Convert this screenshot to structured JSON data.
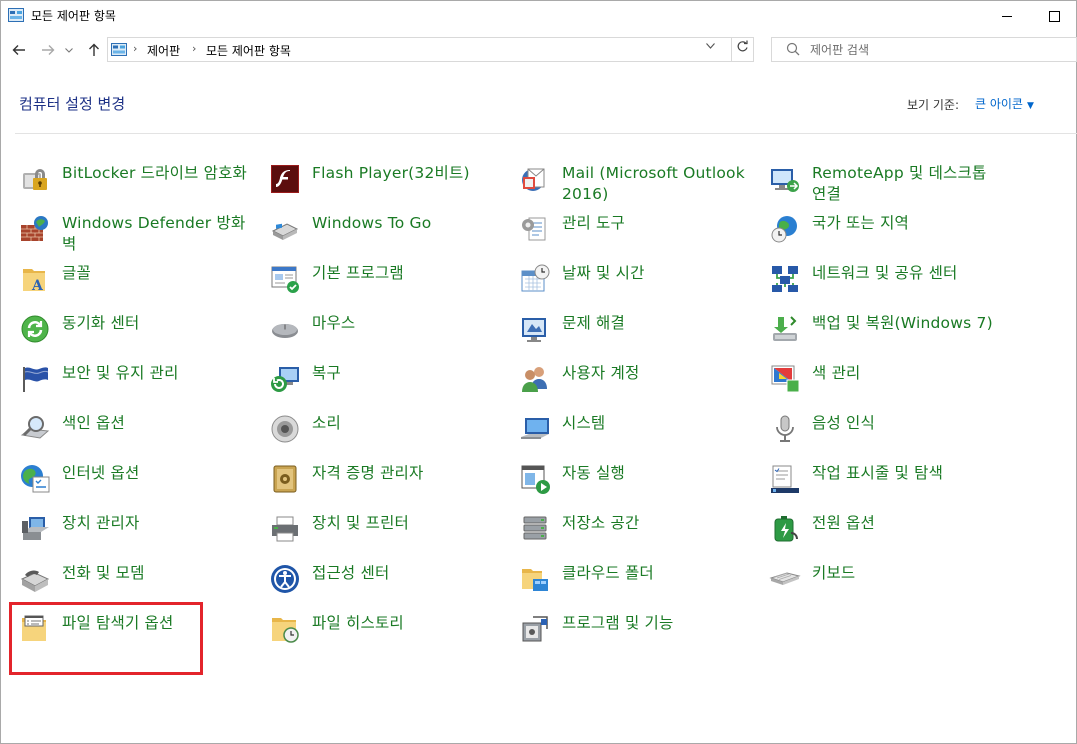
{
  "window": {
    "title": "모든 제어판 항목"
  },
  "nav": {
    "back_icon": "arrow-left-icon",
    "forward_icon": "arrow-right-icon",
    "recent_icon": "chevron-down-icon",
    "up_icon": "arrow-up-icon"
  },
  "address": {
    "crumbs": [
      "제어판",
      "모든 제어판 항목"
    ],
    "refresh_icon": "refresh-icon"
  },
  "search": {
    "placeholder": "제어판 검색"
  },
  "header": {
    "title": "컴퓨터 설정 변경",
    "view_label": "보기 기준:",
    "view_value": "큰 아이콘"
  },
  "items": [
    {
      "label": "BitLocker 드라이브 암호화",
      "icon": "bitlocker-icon"
    },
    {
      "label": "Flash Player(32비트)",
      "icon": "flash-icon"
    },
    {
      "label": "Mail (Microsoft Outlook 2016)",
      "icon": "mail-icon"
    },
    {
      "label": "RemoteApp 및 데스크톱 연결",
      "icon": "remoteapp-icon"
    },
    {
      "label": "Windows Defender 방화벽",
      "icon": "firewall-icon"
    },
    {
      "label": "Windows To Go",
      "icon": "usb-drive-icon"
    },
    {
      "label": "관리 도구",
      "icon": "admin-tools-icon"
    },
    {
      "label": "국가 또는 지역",
      "icon": "globe-clock-icon"
    },
    {
      "label": "글꼴",
      "icon": "fonts-folder-icon"
    },
    {
      "label": "기본 프로그램",
      "icon": "default-programs-icon"
    },
    {
      "label": "날짜 및 시간",
      "icon": "date-time-icon"
    },
    {
      "label": "네트워크 및 공유 센터",
      "icon": "network-icon"
    },
    {
      "label": "동기화 센터",
      "icon": "sync-icon"
    },
    {
      "label": "마우스",
      "icon": "mouse-icon"
    },
    {
      "label": "문제 해결",
      "icon": "troubleshoot-icon"
    },
    {
      "label": "백업 및 복원(Windows 7)",
      "icon": "backup-icon"
    },
    {
      "label": "보안 및 유지 관리",
      "icon": "flag-icon"
    },
    {
      "label": "복구",
      "icon": "recovery-icon"
    },
    {
      "label": "사용자 계정",
      "icon": "users-icon"
    },
    {
      "label": "색 관리",
      "icon": "color-management-icon"
    },
    {
      "label": "색인 옵션",
      "icon": "indexing-icon"
    },
    {
      "label": "소리",
      "icon": "speaker-icon"
    },
    {
      "label": "시스템",
      "icon": "system-icon"
    },
    {
      "label": "음성 인식",
      "icon": "microphone-icon"
    },
    {
      "label": "인터넷 옵션",
      "icon": "internet-options-icon"
    },
    {
      "label": "자격 증명 관리자",
      "icon": "credential-vault-icon"
    },
    {
      "label": "자동 실행",
      "icon": "autoplay-icon"
    },
    {
      "label": "작업 표시줄 및 탐색",
      "icon": "taskbar-icon"
    },
    {
      "label": "장치 관리자",
      "icon": "device-manager-icon"
    },
    {
      "label": "장치 및 프린터",
      "icon": "printer-icon"
    },
    {
      "label": "저장소 공간",
      "icon": "storage-spaces-icon"
    },
    {
      "label": "전원 옵션",
      "icon": "battery-icon"
    },
    {
      "label": "전화 및 모뎀",
      "icon": "phone-icon"
    },
    {
      "label": "접근성 센터",
      "icon": "ease-of-access-icon"
    },
    {
      "label": "클라우드 폴더",
      "icon": "work-folders-icon"
    },
    {
      "label": "키보드",
      "icon": "keyboard-icon"
    },
    {
      "label": "파일 탐색기 옵션",
      "icon": "folder-options-icon"
    },
    {
      "label": "파일 히스토리",
      "icon": "file-history-icon"
    },
    {
      "label": "프로그램 및 기능",
      "icon": "programs-features-icon"
    }
  ],
  "colors": {
    "link_green": "#1a7a24",
    "title_blue": "#1e3287",
    "view_blue": "#0066cc",
    "highlight_red": "#e3242b"
  }
}
